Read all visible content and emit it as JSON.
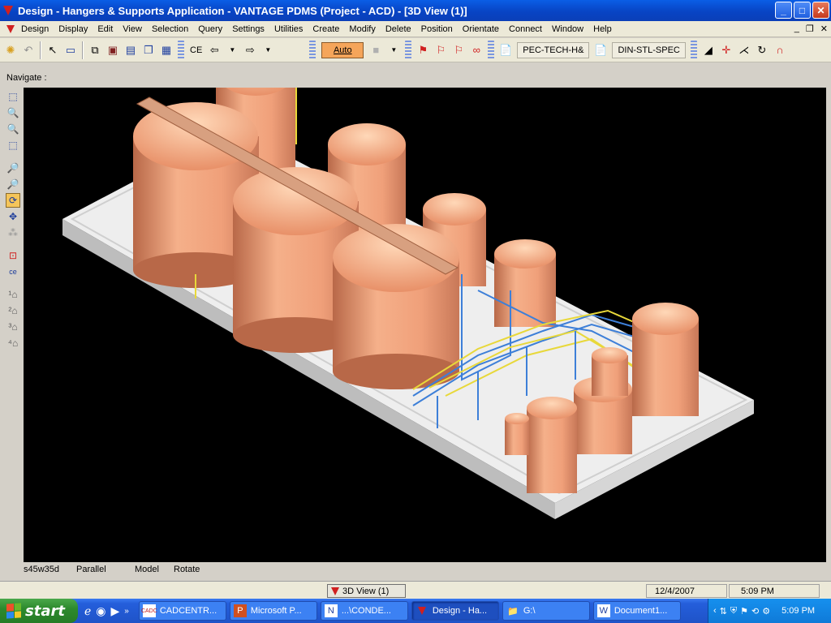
{
  "window": {
    "title": "Design - Hangers & Supports Application - VANTAGE PDMS (Project - ACD) - [3D View (1)]",
    "minimize": "_",
    "maximize": "□",
    "close": "✕"
  },
  "menu": {
    "items": [
      "Design",
      "Display",
      "Edit",
      "View",
      "Selection",
      "Query",
      "Settings",
      "Utilities",
      "Create",
      "Modify",
      "Delete",
      "Position",
      "Orientate",
      "Connect",
      "Window",
      "Help"
    ],
    "mdi_min": "_",
    "mdi_restore": "❐",
    "mdi_close": "✕"
  },
  "toolbar": {
    "ce_label": "CE",
    "auto_label": "Auto",
    "spec1": "PEC-TECH-H&",
    "spec2": "DIN-STL-SPEC"
  },
  "navigate_label": "Navigate :",
  "status": {
    "view_dir": "s45w35d",
    "projection": "Parallel",
    "mode": "Model",
    "action": "Rotate"
  },
  "docbar": {
    "view_tab": "3D View (1)",
    "date": "12/4/2007",
    "time": "5:09 PM"
  },
  "taskbar": {
    "start": "start",
    "tasks": [
      "CADCENTR...",
      "Microsoft P...",
      "...\\CONDE...",
      "Design - Ha...",
      "G:\\",
      "Document1..."
    ],
    "clock": "5:09 PM"
  },
  "colors": {
    "tank": "#f0a07a",
    "steel": "#3d7fd8",
    "pipe": "#e8d83a",
    "slab": "#e8e8e8"
  }
}
